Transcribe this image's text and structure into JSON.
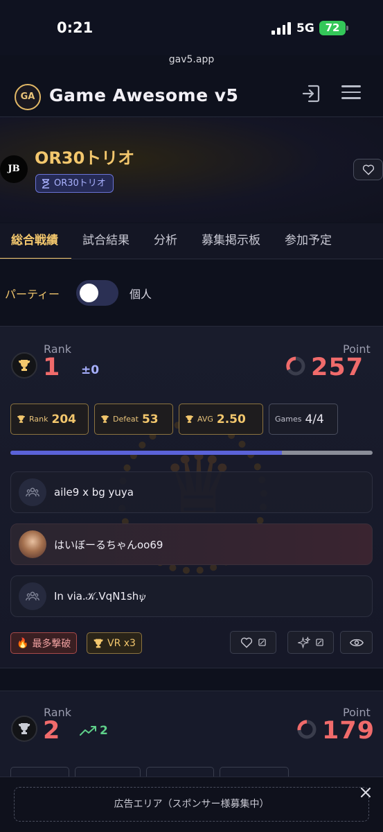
{
  "status_bar": {
    "time": "0:21",
    "network": "5G",
    "battery": "72"
  },
  "browser": {
    "url": "gav5.app"
  },
  "header": {
    "logo_text": "GA",
    "title": "Game Awesome v5"
  },
  "team": {
    "avatar_text": "JB",
    "name": "OR30トリオ",
    "tag": "OR30トリオ"
  },
  "tabs": [
    {
      "label": "総合戦績",
      "active": true
    },
    {
      "label": "試合結果"
    },
    {
      "label": "分析"
    },
    {
      "label": "募集掲示板"
    },
    {
      "label": "参加予定"
    }
  ],
  "toggle": {
    "left_label": "パーティー",
    "right_label": "個人"
  },
  "card1": {
    "rank_label": "Rank",
    "rank": "1",
    "rank_change": "±0",
    "point_label": "Point",
    "point": "257",
    "stats": [
      {
        "label": "Rank",
        "value": "204"
      },
      {
        "label": "Defeat",
        "value": "53"
      },
      {
        "label": "AVG",
        "value": "2.50"
      },
      {
        "label": "Games",
        "value": "4/4"
      }
    ],
    "progress": 0.75,
    "members": [
      {
        "name": "aile9 x bg yuya"
      },
      {
        "name": "はいぼーるちゃんoo69"
      },
      {
        "name": "In via.𝒦.VqN1sh𝜓"
      }
    ],
    "badges": {
      "most_kills": "最多撃破",
      "vr": "VR x3"
    }
  },
  "card2": {
    "rank_label": "Rank",
    "rank": "2",
    "rank_change": "2",
    "point_label": "Point",
    "point": "179"
  },
  "ad": {
    "text": "広告エリア（スポンサー様募集中）"
  },
  "colors": {
    "accent_gold": "#f3c76d",
    "rank_red": "#f06b6b",
    "progress_blue": "#5a62d8",
    "up_green": "#5fd08a"
  }
}
